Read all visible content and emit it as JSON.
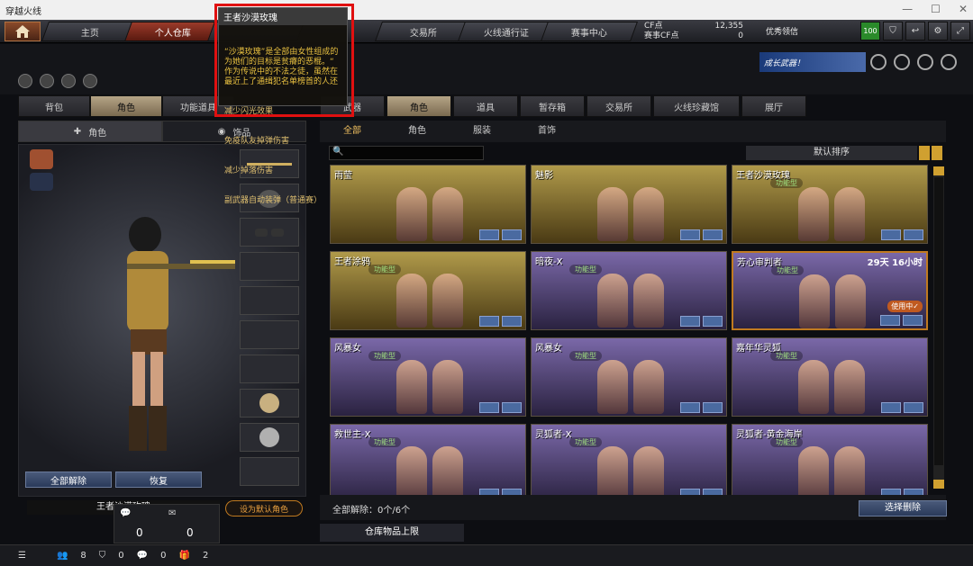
{
  "window": {
    "title": "穿越火线"
  },
  "nav": {
    "tabs": [
      "主页",
      "个人仓库",
      "",
      "交易所",
      "火线通行证",
      "赛事中心"
    ],
    "active_index": 1
  },
  "currency": {
    "cf_label": "CF点",
    "cf_value": "12,355",
    "match_label": "赛事CF点",
    "match_value": "0",
    "vip_label": "优秀领信"
  },
  "top_right": {
    "level": "100"
  },
  "banner": {
    "text": "成长武器！"
  },
  "left_tabs": [
    "背包",
    "角色",
    "功能道具"
  ],
  "left_tabs_active": 1,
  "sub_tabs": [
    {
      "label": "角色",
      "icon": "character-icon"
    },
    {
      "label": "饰品",
      "icon": "accessory-icon"
    }
  ],
  "left_buttons": {
    "unequip_all": "全部解除",
    "restore": "恢复"
  },
  "character_name": "王者沙漠玫瑰",
  "set_default": "设为默认角色",
  "messages": {
    "chat": "0",
    "mail": "0"
  },
  "bottom_bar": {
    "val1": "8",
    "val2": "0",
    "val3": "0",
    "val4": "2"
  },
  "right_tabs": [
    "武器",
    "角色",
    "道具",
    "暂存箱",
    "交易所",
    "火线珍藏馆",
    "展厅"
  ],
  "right_tabs_active": 1,
  "filter_tabs": [
    "全部",
    "角色",
    "服装",
    "首饰"
  ],
  "filter_active": 0,
  "sort_label": "默认排序",
  "cards": [
    {
      "name": "雨莹",
      "tag": "",
      "style": "gold"
    },
    {
      "name": "魅影",
      "tag": "",
      "style": "gold"
    },
    {
      "name": "王者沙漠玫瑰",
      "tag": "功能型",
      "style": "gold"
    },
    {
      "name": "王者涂鸦",
      "tag": "功能型",
      "style": "gold"
    },
    {
      "name": "暗夜-X",
      "tag": "功能型",
      "style": "purple"
    },
    {
      "name": "芳心审判者",
      "tag": "功能型",
      "style": "purple",
      "timer": "29天 16小时",
      "inuse": "使用中✓",
      "selected": true
    },
    {
      "name": "风暴女",
      "tag": "功能型",
      "style": "purple"
    },
    {
      "name": "风暴女",
      "tag": "功能型",
      "style": "purple"
    },
    {
      "name": "嘉年华灵狐",
      "tag": "功能型",
      "style": "purple"
    },
    {
      "name": "救世主-X",
      "tag": "功能型",
      "style": "purple"
    },
    {
      "name": "灵狐者-X",
      "tag": "功能型",
      "style": "purple"
    },
    {
      "name": "灵狐者-黄金海岸",
      "tag": "功能型",
      "style": "purple"
    }
  ],
  "bottom_right": {
    "unequip_text": "全部解除：0个/6个",
    "clear_selection": "选择删除",
    "storage_limit": "仓库物品上限"
  },
  "tooltip": {
    "title": "王者沙漠玫瑰",
    "desc": "“沙漠玫瑰”是全部由女性组成的\n为她们的目标是贫瘠的恶棍。“\n作为传说中的不法之徒，虽然在\n最近上了通缉犯名单榜首的人还",
    "effects": [
      "减少闪光效果",
      "免疫队友掉弹伤害",
      "减少掉落伤害",
      "副武器自动装弹（普通赛）"
    ]
  }
}
